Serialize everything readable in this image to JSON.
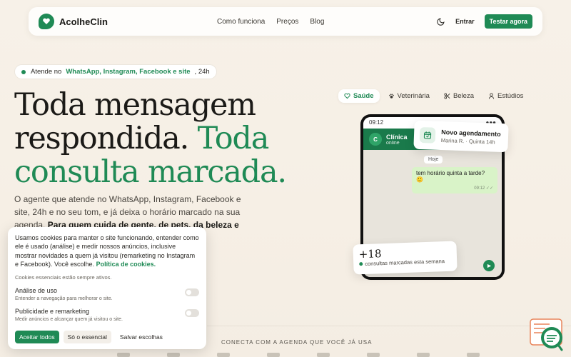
{
  "brand": {
    "name": "AcolheClin"
  },
  "nav": {
    "links": [
      "Como funciona",
      "Preços",
      "Blog"
    ],
    "login": "Entrar",
    "cta": "Testar agora"
  },
  "badge": {
    "prefix": "Atende no",
    "channels": "WhatsApp, Instagram, Facebook e site",
    "suffix": ", 24h"
  },
  "hero": {
    "line1": "Toda mensagem",
    "line2": "respondida.",
    "accent1": "Toda",
    "accent2": "consulta marcada."
  },
  "subtitle": {
    "text": "O agente que atende no WhatsApp, Instagram, Facebook e site, 24h e no seu tom, e já deixa o horário marcado na sua agenda.",
    "bold": "Para quem cuida de gente, de pets, da beleza e do"
  },
  "tabs": [
    "Saúde",
    "Veterinária",
    "Beleza",
    "Estúdios"
  ],
  "phone": {
    "time": "09:12",
    "contact": "Clínica",
    "initial": "C",
    "status": "online",
    "day": "Hoje",
    "message": "tem horário quinta a tarde? 🙂",
    "message_time": "09:12 ✓✓"
  },
  "notification": {
    "title": "Novo agendamento",
    "subtitle": "Marina R. · Quinta 14h"
  },
  "stat": {
    "value": "+18",
    "label": "consultas marcadas esta semana"
  },
  "cookie": {
    "text": "Usamos cookies para manter o site funcionando, entender como ele é usado (análise) e medir nossos anúncios, inclusive mostrar novidades a quem já visitou (remarketing no Instagram e Facebook). Você escolhe.",
    "link": "Política de cookies.",
    "note": "Cookies essenciais estão sempre ativos.",
    "analytics_title": "Análise de uso",
    "analytics_desc": "Entender a navegação para melhorar o site.",
    "ads_title": "Publicidade e remarketing",
    "ads_desc": "Medir anúncios e alcançar quem já visitou o site.",
    "accept_all": "Aceitar todos",
    "essential_only": "Só o essencial",
    "save": "Salvar escolhas"
  },
  "connect": "CONECTA COM A AGENDA QUE VOCÊ JÁ USA",
  "colors": {
    "brand": "#1f8a55",
    "background": "#f6efe5"
  }
}
